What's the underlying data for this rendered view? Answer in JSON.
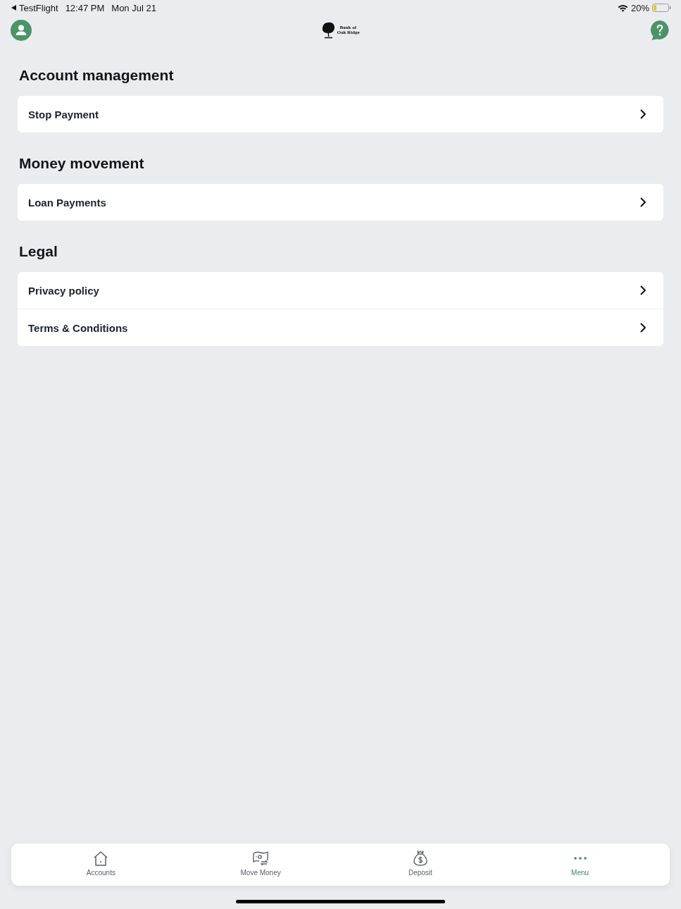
{
  "status_bar": {
    "back_label": "TestFlight",
    "time": "12:47 PM",
    "date": "Mon Jul 21",
    "battery": "20%"
  },
  "header": {
    "logo_text": [
      "Bank of",
      "Oak Ridge"
    ]
  },
  "sections": [
    {
      "title": "Account management",
      "items": [
        {
          "label": "Stop Payment"
        }
      ]
    },
    {
      "title": "Money movement",
      "items": [
        {
          "label": "Loan Payments"
        }
      ]
    },
    {
      "title": "Legal",
      "items": [
        {
          "label": "Privacy policy"
        },
        {
          "label": "Terms & Conditions"
        }
      ]
    }
  ],
  "tabs": [
    {
      "label": "Accounts",
      "selected": false
    },
    {
      "label": "Move Money",
      "selected": false
    },
    {
      "label": "Deposit",
      "selected": false
    },
    {
      "label": "Menu",
      "selected": true
    }
  ]
}
